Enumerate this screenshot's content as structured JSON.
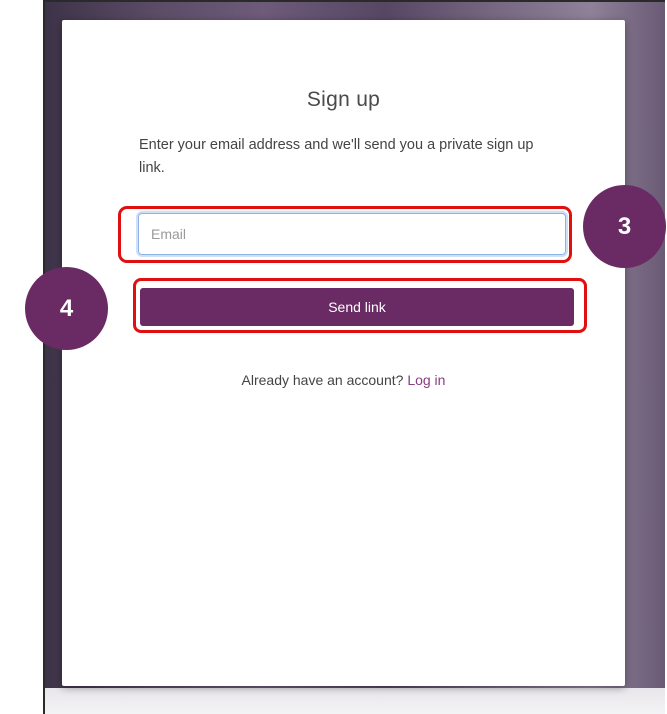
{
  "signup": {
    "title": "Sign up",
    "description": "Enter your email address and we'll send you a private sign up link.",
    "email_placeholder": "Email",
    "email_value": "",
    "send_button_label": "Send link",
    "login_prompt": "Already have an account?",
    "login_link_label": "Log in"
  },
  "annotations": {
    "step_3": "3",
    "step_4": "4",
    "highlight_color": "#e01010",
    "step_badge_color": "#6a2a63"
  },
  "colors": {
    "accent": "#6a2a63",
    "link": "#8a3b82"
  }
}
